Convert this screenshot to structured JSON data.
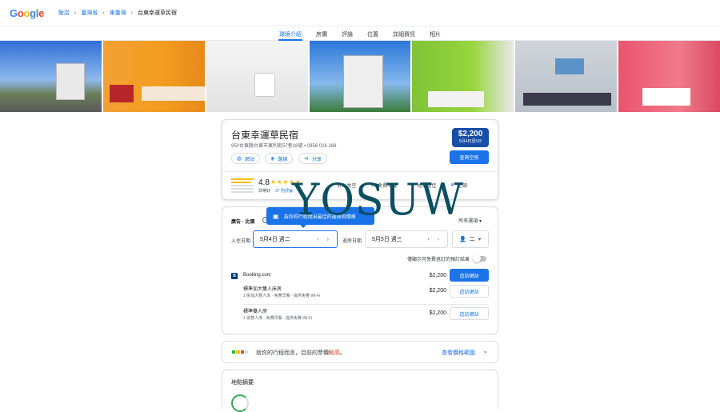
{
  "logo": "Google",
  "breadcrumb": [
    "飯店",
    "臺灣省",
    "東臺灣",
    "台東幸運草民宿"
  ],
  "tabs": [
    "環境介紹",
    "房價",
    "評論",
    "位置",
    "詳細資訊",
    "相片"
  ],
  "hotel": {
    "name": "台東幸運草民宿",
    "address": "950台東縣台東市東利街57巷18號 • 0956 026 268",
    "price": "$2,200",
    "date": "5月4日至5日",
    "check_button": "查詢空房",
    "actions": [
      "網站",
      "路線",
      "分享"
    ],
    "rating": "4.8",
    "rating_label": "非常好",
    "reviews": "37 則評論",
    "amenities": [
      "非公共空",
      "免費早餐",
      "地點絕佳",
      "空調"
    ]
  },
  "booking": {
    "ad_label": "廣告 · 比價",
    "sort_label": "所有選項",
    "tooltip": "為你的行程找出最佳的選擇和價格",
    "checkin_label": "入住日期",
    "checkin_value": "5月4日 週二",
    "checkout_label": "退房日期",
    "checkout_value": "5月5日 週三",
    "guests_value": "二",
    "free_cancel_label": "僅顯示可免費退訂的預訂結果",
    "provider": "Booking.com",
    "provider_price": "$2,200",
    "visit_label": "造訪網站",
    "rooms": [
      {
        "name": "標準加大雙人床房",
        "desc": "1 張加大雙人床 · 免費早餐 · 提供免費 Wi-Fi",
        "price": "$2,200",
        "visit": "造訪網站"
      },
      {
        "name": "標準雙人房",
        "desc": "1 張雙人床 · 免費早餐 · 提供免費 Wi-Fi",
        "price": "$2,200",
        "visit": "造訪網站"
      }
    ]
  },
  "price_insight": {
    "text": "就你的行程而言，目前的票價較高。",
    "highlight": "較高",
    "link": "查看價格範圍"
  },
  "location": {
    "title": "地點摘要"
  },
  "watermark": "YOSUW",
  "colors": {
    "accent": "#1a73e8",
    "price_box": "#174ea6",
    "watermark": "#0b4f60",
    "high": "#d93025"
  }
}
